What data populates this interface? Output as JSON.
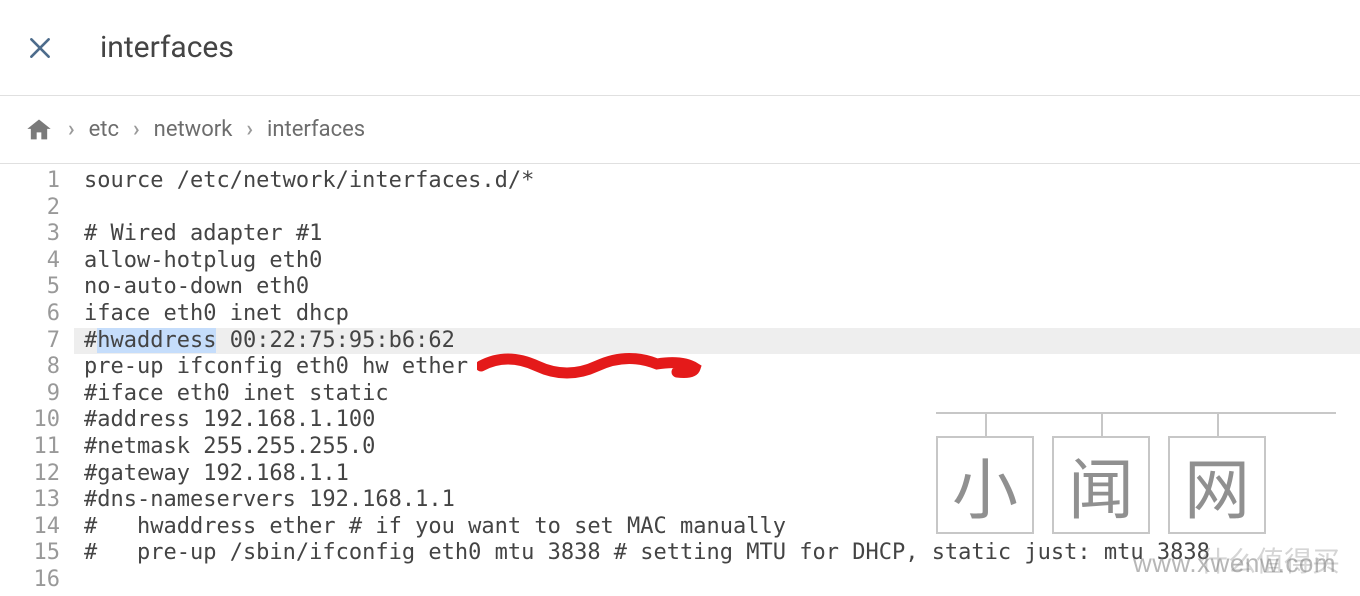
{
  "header": {
    "title": "interfaces"
  },
  "breadcrumb": {
    "items": [
      "etc",
      "network",
      "interfaces"
    ]
  },
  "editor": {
    "active_line": 7,
    "selection": "hwaddress",
    "lines": [
      "source /etc/network/interfaces.d/*",
      "",
      "# Wired adapter #1",
      "allow-hotplug eth0",
      "no-auto-down eth0",
      "iface eth0 inet dhcp",
      "#hwaddress 00:22:75:95:b6:62",
      "pre-up ifconfig eth0 hw ether ",
      "#iface eth0 inet static",
      "#address 192.168.1.100",
      "#netmask 255.255.255.0",
      "#gateway 192.168.1.1",
      "#dns-nameservers 192.168.1.1",
      "#   hwaddress ether # if you want to set MAC manually",
      "#   pre-up /sbin/ifconfig eth0 mtu 3838 # setting MTU for DHCP, static just: mtu 3838",
      ""
    ],
    "line7_prefix": "#",
    "line7_suffix": " 00:22:75:95:b6:62"
  },
  "watermark": {
    "chars": [
      "小",
      "闻",
      "网"
    ],
    "url": "www.xwenw.com",
    "cn_mark": "什么值得买"
  }
}
